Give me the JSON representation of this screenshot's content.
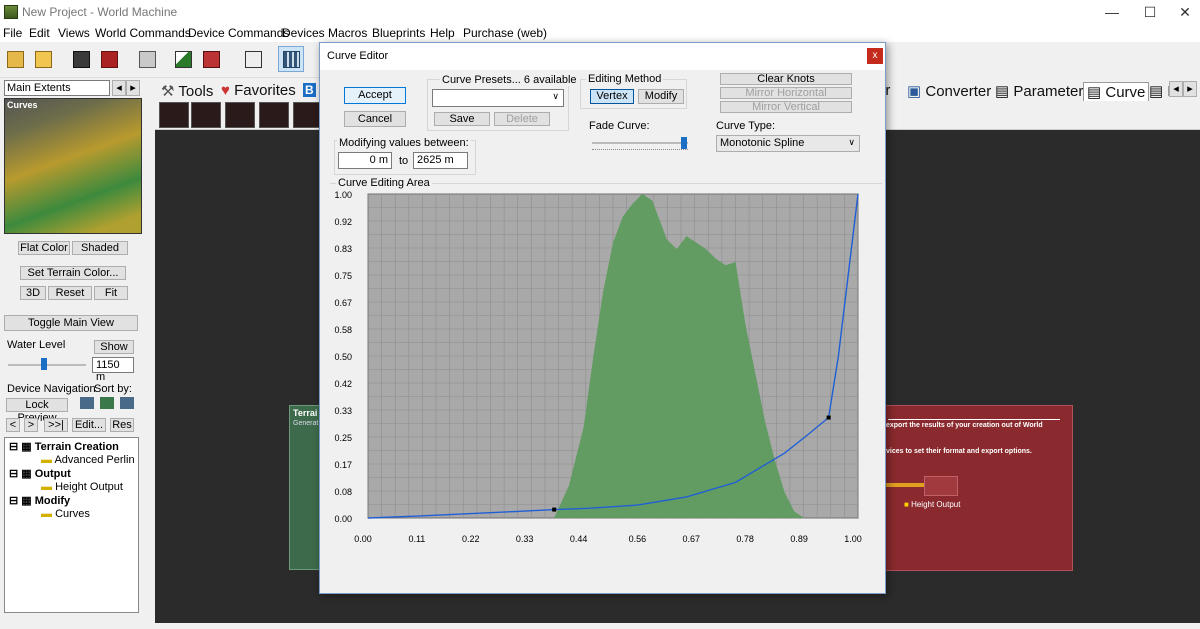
{
  "window": {
    "title": "New Project - World Machine"
  },
  "menu": [
    "File",
    "Edit",
    "Views",
    "World Commands",
    "Device Commands",
    "Devices",
    "Macros",
    "Blueprints",
    "Help",
    "Purchase (web)"
  ],
  "left": {
    "extents_select": "Main Extents",
    "preview_title": "Curves",
    "flat_color": "Flat Color",
    "shaded": "Shaded",
    "set_terrain_color": "Set Terrain Color...",
    "btn_3d": "3D",
    "btn_reset": "Reset",
    "btn_fit": "Fit",
    "toggle_main_view": "Toggle Main View",
    "water_level_label": "Water Level",
    "show": "Show",
    "water_value": "1150 m",
    "device_navigation": "Device Navigation",
    "sort_by": "Sort by:",
    "lock_preview": "Lock Preview",
    "nav_prev": "<",
    "nav_next": ">",
    "nav_last": ">>|",
    "edit": "Edit...",
    "res": "Res",
    "tree": [
      {
        "label": "Terrain Creation",
        "children": [
          "Advanced Perlin"
        ]
      },
      {
        "label": "Output",
        "children": [
          "Height Output"
        ]
      },
      {
        "label": "Modify",
        "children": [
          "Curves"
        ]
      }
    ]
  },
  "tabs": {
    "tools": "Tools",
    "favorites": "Favorites",
    "b": "B",
    "r_partial": "or",
    "converter": "Converter",
    "parameter": "Parameter",
    "curve": "Curve",
    "f_partial": "F"
  },
  "canvas": {
    "terrain_box_title": "Terrai",
    "terrain_box_sub": "Generat",
    "output_text1": "export the results of your creation out of World",
    "output_text2": "vices to set their format and export options.",
    "height_output": "Height Output"
  },
  "dialog": {
    "title": "Curve Editor",
    "close": "x",
    "accept": "Accept",
    "cancel": "Cancel",
    "presets_label": "Curve Presets... 6 available",
    "save": "Save",
    "delete": "Delete",
    "editing_method": "Editing Method",
    "vertex": "Vertex",
    "modify": "Modify",
    "clear_knots": "Clear Knots",
    "mirror_horizontal": "Mirror Horizontal",
    "mirror_vertical": "Mirror Vertical",
    "modifying_label": "Modifying values between:",
    "from_value": "0 m",
    "to_label": "to",
    "to_value": "2625 m",
    "fade_curve": "Fade Curve:",
    "fade_value": 1.0,
    "curve_type_label": "Curve Type:",
    "curve_type": "Monotonic Spline",
    "editing_area": "Curve Editing Area"
  },
  "chart_data": {
    "type": "area",
    "title": "",
    "xlim": [
      0,
      1
    ],
    "ylim": [
      0,
      1
    ],
    "x_ticks": [
      "0.00",
      "0.11",
      "0.22",
      "0.33",
      "0.44",
      "0.56",
      "0.67",
      "0.78",
      "0.89",
      "1.00"
    ],
    "y_ticks": [
      "1.00",
      "0.92",
      "0.83",
      "0.75",
      "0.67",
      "0.58",
      "0.50",
      "0.42",
      "0.33",
      "0.25",
      "0.17",
      "0.08",
      "0.00"
    ],
    "histogram": {
      "x": [
        0.38,
        0.41,
        0.44,
        0.46,
        0.48,
        0.5,
        0.52,
        0.54,
        0.56,
        0.58,
        0.59,
        0.61,
        0.63,
        0.65,
        0.67,
        0.69,
        0.71,
        0.73,
        0.75,
        0.77,
        0.79,
        0.81,
        0.83,
        0.85,
        0.87,
        0.89,
        0.91,
        0.93
      ],
      "y": [
        0.0,
        0.1,
        0.28,
        0.5,
        0.7,
        0.85,
        0.93,
        0.97,
        1.0,
        0.98,
        0.94,
        0.86,
        0.83,
        0.87,
        0.85,
        0.83,
        0.8,
        0.78,
        0.79,
        0.6,
        0.45,
        0.3,
        0.18,
        0.08,
        0.02,
        0.0,
        0.0,
        0.0
      ],
      "color": "#5f9b5f"
    },
    "curve": {
      "color": "#1f5fd6",
      "x": [
        0.0,
        0.1,
        0.2,
        0.3,
        0.38,
        0.45,
        0.55,
        0.65,
        0.75,
        0.85,
        0.9,
        0.94,
        0.96,
        0.98,
        1.0
      ],
      "y": [
        0.0,
        0.006,
        0.013,
        0.02,
        0.026,
        0.03,
        0.04,
        0.065,
        0.11,
        0.2,
        0.26,
        0.31,
        0.5,
        0.75,
        1.0
      ]
    },
    "knots": [
      {
        "x": 0.38,
        "y": 0.026
      },
      {
        "x": 0.94,
        "y": 0.31
      }
    ],
    "grid": true
  }
}
